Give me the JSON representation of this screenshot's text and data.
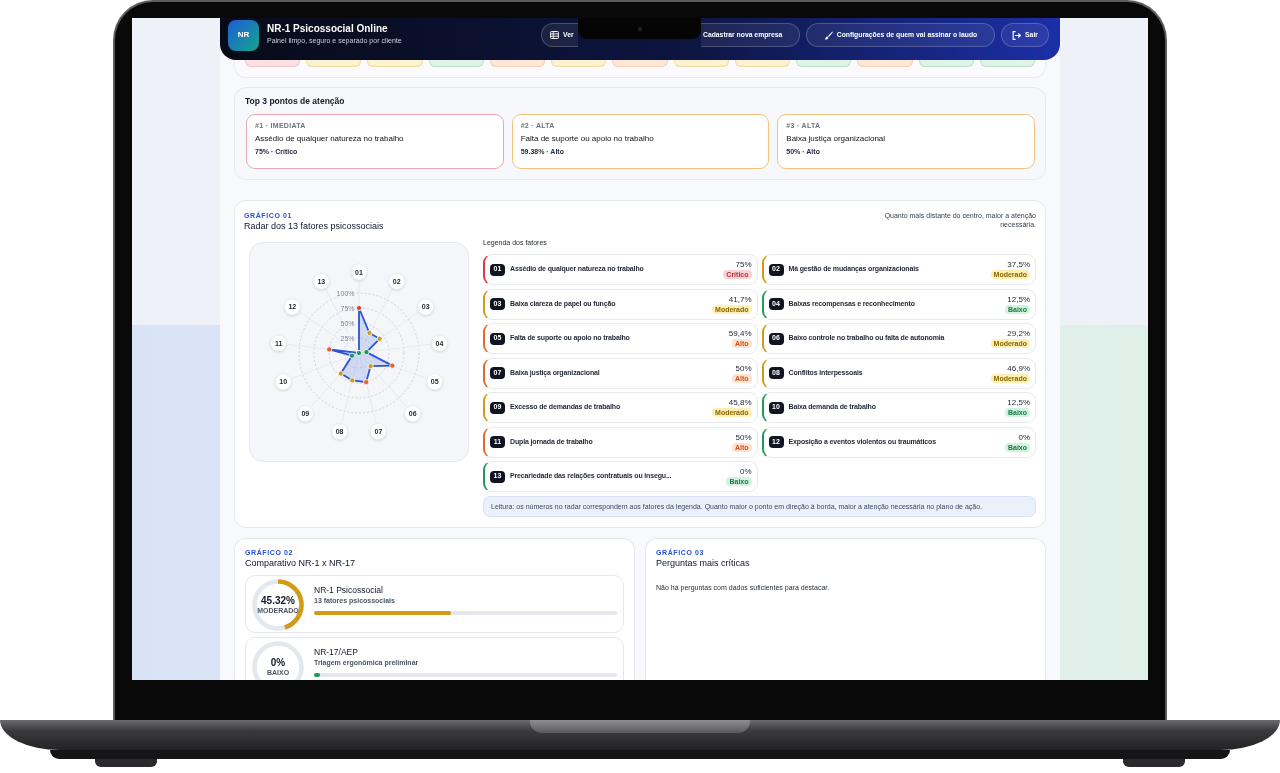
{
  "header": {
    "logo": "NR",
    "title": "NR-1 Psicossocial Online",
    "subtitle": "Painel limpo, seguro e separado por cliente",
    "buttons": [
      "Ver",
      "Cadastrar nova empresa",
      "Configurações de quem vai assinar o laudo",
      "Sair"
    ]
  },
  "top_attention": {
    "title": "Top 3 pontos de atenção",
    "items": [
      {
        "rank": "#1 · IMEDIATA",
        "title": "Assédio de qualquer natureza no trabalho",
        "meta": "75% · Crítico",
        "kind": "critical"
      },
      {
        "rank": "#2 · ALTA",
        "title": "Falta de suporte ou apoio no trabalho",
        "meta": "59.38% · Alto",
        "kind": "high"
      },
      {
        "rank": "#3 · ALTA",
        "title": "Baixa justiça organizacional",
        "meta": "50% · Alto",
        "kind": "high"
      }
    ]
  },
  "radar": {
    "eyebrow": "GRÁFICO 01",
    "title": "Radar dos 13 fatores psicossociais",
    "note": "Quanto mais distante do centro, maior a atenção necessária.",
    "chart_data": {
      "type": "radar",
      "categories": [
        "01",
        "02",
        "03",
        "04",
        "05",
        "06",
        "07",
        "08",
        "09",
        "10",
        "11",
        "12",
        "13"
      ],
      "values": [
        75,
        37.5,
        41.7,
        12.5,
        59.4,
        29.2,
        50,
        46.9,
        45.8,
        12.5,
        50,
        0,
        0
      ],
      "ylim": [
        0,
        100
      ],
      "yticks": [
        {
          "value": 25,
          "label": "25%"
        },
        {
          "value": 50,
          "label": "50%"
        },
        {
          "value": 75,
          "label": "75%"
        },
        {
          "value": 100,
          "label": "100%"
        }
      ]
    },
    "legend_title": "Legenda dos fatores",
    "factors": [
      {
        "num": "01",
        "name": "Assédio de qualquer natureza no trabalho",
        "value": "75%",
        "badge": "Crítico",
        "kind": "critical"
      },
      {
        "num": "02",
        "name": "Má gestão de mudanças organizacionais",
        "value": "37,5%",
        "badge": "Moderado",
        "kind": "moderate"
      },
      {
        "num": "03",
        "name": "Baixa clareza de papel ou função",
        "value": "41,7%",
        "badge": "Moderado",
        "kind": "moderate"
      },
      {
        "num": "04",
        "name": "Baixas recompensas e reconhecimento",
        "value": "12,5%",
        "badge": "Baixo",
        "kind": "low"
      },
      {
        "num": "05",
        "name": "Falta de suporte ou apoio no trabalho",
        "value": "59,4%",
        "badge": "Alto",
        "kind": "high"
      },
      {
        "num": "06",
        "name": "Baixo controle no trabalho ou falta de autonomia",
        "value": "29,2%",
        "badge": "Moderado",
        "kind": "moderate"
      },
      {
        "num": "07",
        "name": "Baixa justiça organizacional",
        "value": "50%",
        "badge": "Alto",
        "kind": "high"
      },
      {
        "num": "08",
        "name": "Conflitos interpessoais",
        "value": "46,9%",
        "badge": "Moderado",
        "kind": "moderate"
      },
      {
        "num": "09",
        "name": "Excesso de demandas de trabalho",
        "value": "45,8%",
        "badge": "Moderado",
        "kind": "moderate"
      },
      {
        "num": "10",
        "name": "Baixa demanda de trabalho",
        "value": "12,5%",
        "badge": "Baixo",
        "kind": "low"
      },
      {
        "num": "11",
        "name": "Dupla jornada de trabalho",
        "value": "50%",
        "badge": "Alto",
        "kind": "high"
      },
      {
        "num": "12",
        "name": "Exposição a eventos violentos ou traumáticos",
        "value": "0%",
        "badge": "Baixo",
        "kind": "low"
      },
      {
        "num": "13",
        "name": "Precariedade das relações contratuais ou insegu...",
        "value": "0%",
        "badge": "Baixo",
        "kind": "low"
      }
    ],
    "reading_note": "Leitura: os números no radar correspondem aos fatores da legenda. Quanto maior o ponto em direção à borda, maior a atenção necessária no plano de ação."
  },
  "comparison": {
    "eyebrow": "GRÁFICO 02",
    "title": "Comparativo NR-1 x NR-17",
    "items": [
      {
        "value": "45.32%",
        "badge": "MODERADO",
        "title": "NR-1 Psicossocial",
        "subtitle": "13 fatores psicossociais",
        "level": 0.4532,
        "kind": "moderate"
      },
      {
        "value": "0%",
        "badge": "BAIXO",
        "title": "NR-17/AEP",
        "subtitle": "Triagem ergonômica preliminar",
        "level": 0,
        "kind": "low"
      }
    ]
  },
  "critical_questions": {
    "eyebrow": "GRÁFICO 03",
    "title": "Perguntas mais críticas",
    "empty_text": "Não há perguntas com dados suficientes para destacar."
  }
}
